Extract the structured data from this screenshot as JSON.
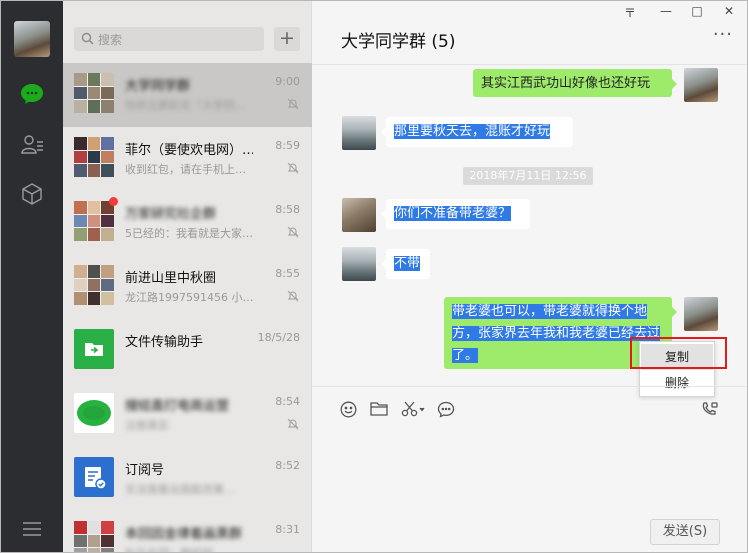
{
  "search": {
    "placeholder": "搜索"
  },
  "conversations": [
    {
      "name": "大学同学群",
      "time": "9:00",
      "preview": "你终古那彩花「大学同…",
      "muted": true
    },
    {
      "name": "菲尔（要使欢电网）…",
      "time": "8:59",
      "preview": "收到红包，请在手机上…",
      "muted": true
    },
    {
      "name": "万家研究社企群",
      "time": "8:58",
      "preview": "5已经的：我看就是大家…",
      "muted": true
    },
    {
      "name": "前进山里中秋圈",
      "time": "8:55",
      "preview": "龙江路1997591456 小…",
      "muted": true
    },
    {
      "name": "文件传输助手",
      "time": "18/5/28",
      "preview": "",
      "muted": false
    },
    {
      "name": "搜结直打电商运营",
      "time": "8:54",
      "preview": "注册高实",
      "muted": true
    },
    {
      "name": "订阅号",
      "time": "8:52",
      "preview": "无法我看出我能改第…",
      "muted": false
    },
    {
      "name": "本回因金律着画黑群",
      "time": "8:31",
      "preview": "杜乐名回：都经到…",
      "muted": false
    }
  ],
  "chat": {
    "title": "大学同学群 (5)",
    "timestamp": "2018年7月11日 12:56",
    "messages": [
      {
        "side": "right",
        "text": "其实江西武功山好像也还好玩"
      },
      {
        "side": "left",
        "text": "那里要秋天去，混账才好玩"
      },
      {
        "side": "left",
        "text": "你们不准备带老婆？"
      },
      {
        "side": "left",
        "text": "不带"
      },
      {
        "side": "right",
        "text": "带老婆也可以，带老婆就得换个地方，张家界去年我和我老婆已经去过了。"
      }
    ]
  },
  "context_menu": {
    "copy": "复制",
    "delete": "删除"
  },
  "window_controls": {
    "pin": "〒",
    "minimize": "—",
    "maximize": "□",
    "close": "✕"
  },
  "send_label": "发送(S)",
  "colors": {
    "self_bubble": "#9eea6a",
    "selection": "#2f7ae5",
    "highlight_box": "#e01b1b",
    "nav_bg": "#2b2d30",
    "chat_icon_active": "#1aad19"
  }
}
